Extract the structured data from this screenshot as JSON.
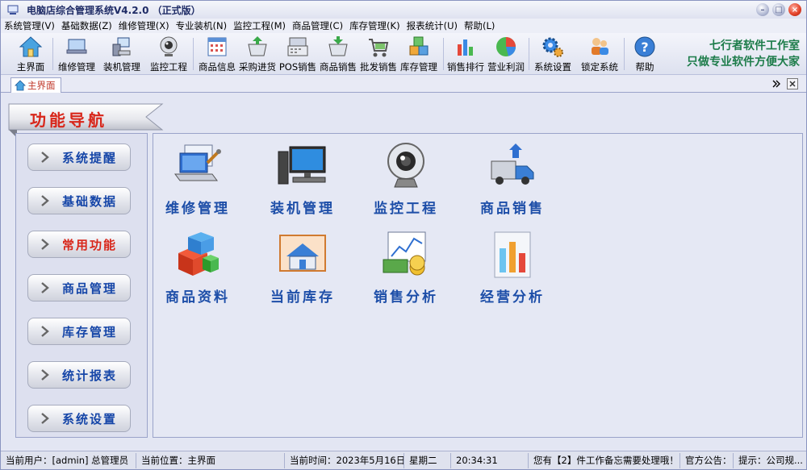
{
  "window": {
    "title": "电脑店综合管理系统V4.2.0 （正式版）",
    "title_icon": "app-icon",
    "controls": [
      "minimize-icon",
      "maximize-icon",
      "close-icon"
    ]
  },
  "menu": [
    "系统管理(V)",
    "基础数据(Z)",
    "维修管理(X)",
    "专业装机(N)",
    "监控工程(M)",
    "商品管理(C)",
    "库存管理(K)",
    "报表统计(U)",
    "帮助(L)"
  ],
  "toolbar": {
    "buttons": [
      {
        "label": "主界面",
        "icon": "home-icon"
      },
      {
        "label": "维修管理",
        "icon": "laptop-repair-icon"
      },
      {
        "label": "装机管理",
        "icon": "computer-icon"
      },
      {
        "label": "监控工程",
        "icon": "webcam-icon"
      },
      {
        "label": "商品信息",
        "icon": "calendar-grid-icon"
      },
      {
        "label": "采购进货",
        "icon": "basket-down-icon"
      },
      {
        "label": "POS销售",
        "icon": "pos-terminal-icon"
      },
      {
        "label": "商品销售",
        "icon": "basket-icon"
      },
      {
        "label": "批发销售",
        "icon": "cart-icon"
      },
      {
        "label": "库存管理",
        "icon": "boxes-icon"
      },
      {
        "label": "销售排行",
        "icon": "bar-chart-icon"
      },
      {
        "label": "营业利润",
        "icon": "pie-chart-icon"
      },
      {
        "label": "系统设置",
        "icon": "gears-icon"
      },
      {
        "label": "锁定系统",
        "icon": "users-lock-icon"
      },
      {
        "label": "帮助",
        "icon": "help-icon"
      }
    ],
    "studio_line1": "七行者软件工作室",
    "studio_line2": "只做专业软件方便大家"
  },
  "tabs": {
    "active": "主界面",
    "controls": [
      "chevron-right-icon",
      "close-tab-icon"
    ]
  },
  "nav": {
    "banner": "功能导航",
    "items": [
      {
        "label": "系统提醒",
        "active": false
      },
      {
        "label": "基础数据",
        "active": false
      },
      {
        "label": "常用功能",
        "active": true
      },
      {
        "label": "商品管理",
        "active": false
      },
      {
        "label": "库存管理",
        "active": false
      },
      {
        "label": "统计报表",
        "active": false
      },
      {
        "label": "系统设置",
        "active": false
      }
    ]
  },
  "main": {
    "tiles": [
      {
        "label": "维修管理",
        "icon": "laptop-repair-icon"
      },
      {
        "label": "装机管理",
        "icon": "desktop-computer-icon"
      },
      {
        "label": "监控工程",
        "icon": "webcam-icon"
      },
      {
        "label": "商品销售",
        "icon": "delivery-truck-icon"
      },
      {
        "label": "商品资料",
        "icon": "cubes-icon"
      },
      {
        "label": "当前库存",
        "icon": "warehouse-icon"
      },
      {
        "label": "销售分析",
        "icon": "money-chart-icon"
      },
      {
        "label": "经营分析",
        "icon": "bar-chart-icon"
      }
    ]
  },
  "status": {
    "user": "当前用户：[admin] 总管理员",
    "location": "当前位置：主界面",
    "time_label": "当前时间：2023年5月16日",
    "weekday": "星期二",
    "clock": "20:34:31",
    "notice": "您有【2】件工作备忘需要处理哦！",
    "announcement": "官方公告：",
    "tip": "提示：公司规..."
  },
  "colors": {
    "nav_text": "#1646a8",
    "nav_active": "#d8261a",
    "tile_text": "#1d4ea8",
    "studio_text": "#1d7c4a"
  }
}
